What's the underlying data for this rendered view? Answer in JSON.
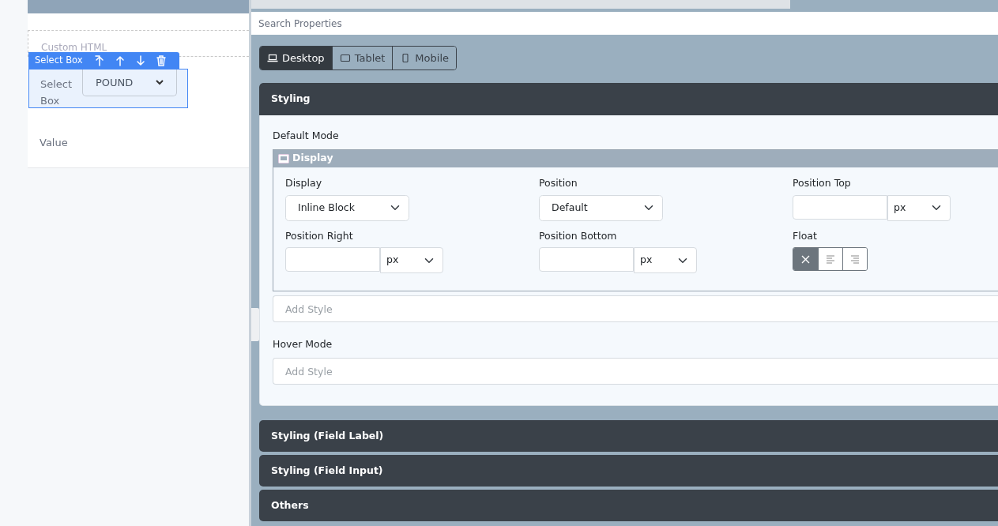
{
  "canvas": {
    "placeholder_block": "Custom HTML",
    "toolbar": {
      "title": "Select Box"
    },
    "field": {
      "label": "Select Box",
      "value": "POUND"
    },
    "value_label": "Value"
  },
  "search": {
    "placeholder": "Search Properties"
  },
  "devices": [
    {
      "label": "Desktop",
      "kind": "laptop",
      "selected": true
    },
    {
      "label": "Tablet",
      "kind": "tablet",
      "selected": false
    },
    {
      "label": "Mobile",
      "kind": "phone",
      "selected": false
    }
  ],
  "sections": [
    {
      "title": "Styling",
      "default_mode": {
        "label": "Default Mode",
        "group": {
          "title": "Display",
          "fields": [
            {
              "kind": "select",
              "label": "Display",
              "value": "Inline Block"
            },
            {
              "kind": "select",
              "label": "Position",
              "value": "Default"
            },
            {
              "kind": "unit",
              "label": "Position Top",
              "unit": "px"
            },
            {
              "kind": "unit",
              "label": "Position Right",
              "unit": "px"
            },
            {
              "kind": "unit",
              "label": "Position Bottom",
              "unit": "px"
            },
            {
              "kind": "float",
              "label": "Float",
              "options": [
                {
                  "kind": "none",
                  "selected": true
                },
                {
                  "kind": "left",
                  "selected": false
                },
                {
                  "kind": "right",
                  "selected": false
                }
              ]
            }
          ]
        },
        "add_style": {
          "placeholder": "Add Style"
        }
      },
      "hover_mode": {
        "label": "Hover Mode",
        "add_style": {
          "placeholder": "Add Style"
        }
      }
    },
    {
      "title": "Styling (Field Label)"
    },
    {
      "title": "Styling (Field Input)"
    },
    {
      "title": "Others"
    }
  ]
}
